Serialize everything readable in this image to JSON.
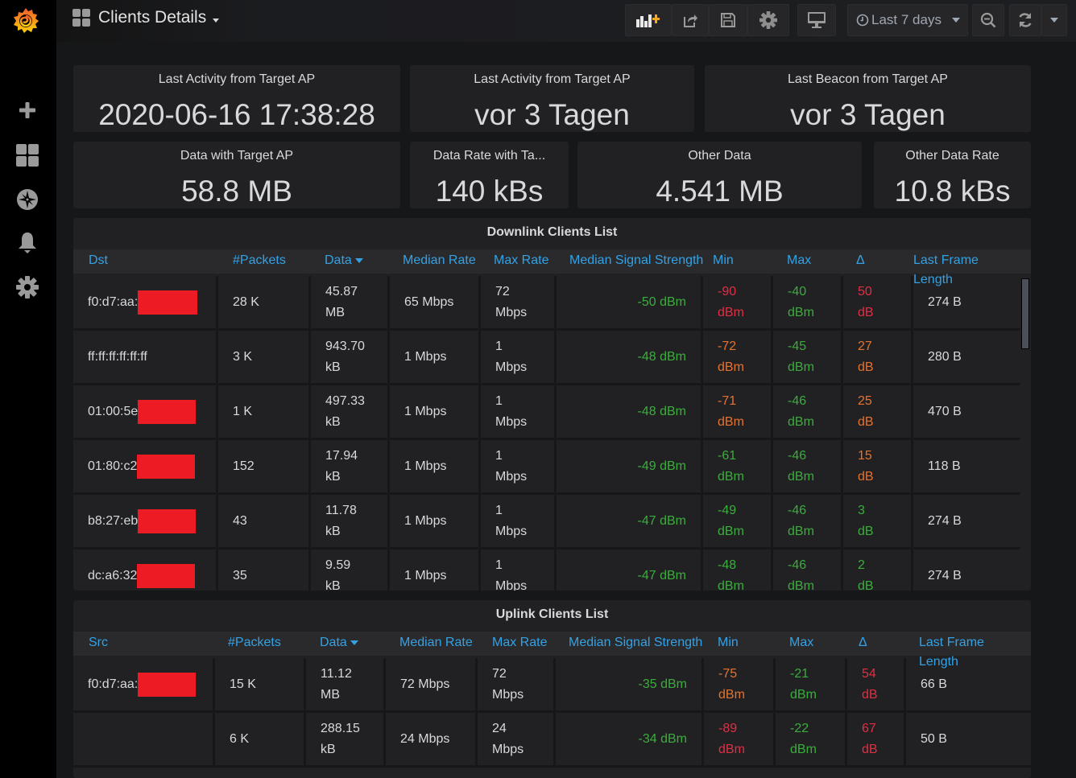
{
  "app": {
    "dashboard_title": "Clients Details"
  },
  "sidebar": {
    "items": [
      {
        "name": "create",
        "icon": "plus-icon"
      },
      {
        "name": "dashboards",
        "icon": "grid-icon"
      },
      {
        "name": "explore",
        "icon": "compass-icon"
      },
      {
        "name": "alerting",
        "icon": "bell-icon"
      },
      {
        "name": "configuration",
        "icon": "gear-icon"
      }
    ]
  },
  "toolbar": {
    "add_panel": "add-panel-icon",
    "share": "share-icon",
    "save": "save-icon",
    "settings": "gear-icon",
    "cycle_view": "monitor-icon",
    "time_range": "Last 7 days",
    "zoom_out": "zoom-out-icon",
    "refresh": "refresh-icon",
    "refresh_interval": "caret-down-icon"
  },
  "stats": [
    {
      "title": "Last Activity from Target AP",
      "value": "2020-06-16 17:38:28"
    },
    {
      "title": "Last Activity from Target AP",
      "value": "vor 3 Tagen"
    },
    {
      "title": "Last Beacon from Target AP",
      "value": "vor 3 Tagen"
    },
    {
      "title": "Data with Target AP",
      "value": "58.8 MB"
    },
    {
      "title": "Data Rate with Ta...",
      "value": "140 kBs"
    },
    {
      "title": "Other Data",
      "value": "4.541 MB"
    },
    {
      "title": "Other Data Rate",
      "value": "10.8 kBs"
    }
  ],
  "downlink": {
    "title": "Downlink Clients List",
    "columns": [
      "Dst",
      "#Packets",
      "Data",
      "Median Rate",
      "Max Rate",
      "Median Signal Strength",
      "Min",
      "Max",
      "Δ",
      "Last Frame",
      "Length"
    ],
    "sorted_column": "Data",
    "rows": [
      {
        "mac": "f0:d7:aa:",
        "redacted": true,
        "packets": "28 K",
        "data": [
          "45.87",
          "MB"
        ],
        "median_rate": "65 Mbps",
        "max_rate": [
          "72",
          "Mbps"
        ],
        "median_signal": "-50 dBm",
        "min": [
          "-90",
          "dBm"
        ],
        "min_color": "red",
        "max": [
          "-40",
          "dBm"
        ],
        "max_color": "green",
        "delta": [
          "50",
          "dB"
        ],
        "delta_color": "red",
        "last_frame": "274 B"
      },
      {
        "mac": "ff:ff:ff:ff:ff:ff",
        "redacted": false,
        "packets": "3 K",
        "data": [
          "943.70",
          "kB"
        ],
        "median_rate": "1 Mbps",
        "max_rate": [
          "1",
          "Mbps"
        ],
        "median_signal": "-48 dBm",
        "min": [
          "-72",
          "dBm"
        ],
        "min_color": "orange",
        "max": [
          "-45",
          "dBm"
        ],
        "max_color": "green",
        "delta": [
          "27",
          "dB"
        ],
        "delta_color": "orange",
        "last_frame": "280 B"
      },
      {
        "mac": "01:00:5e",
        "redacted": true,
        "packets": "1 K",
        "data": [
          "497.33",
          "kB"
        ],
        "median_rate": "1 Mbps",
        "max_rate": [
          "1",
          "Mbps"
        ],
        "median_signal": "-48 dBm",
        "min": [
          "-71",
          "dBm"
        ],
        "min_color": "orange",
        "max": [
          "-46",
          "dBm"
        ],
        "max_color": "green",
        "delta": [
          "25",
          "dB"
        ],
        "delta_color": "orange",
        "last_frame": "470 B"
      },
      {
        "mac": "01:80:c2",
        "redacted": true,
        "packets": "152",
        "data": [
          "17.94",
          "kB"
        ],
        "median_rate": "1 Mbps",
        "max_rate": [
          "1",
          "Mbps"
        ],
        "median_signal": "-49 dBm",
        "min": [
          "-61",
          "dBm"
        ],
        "min_color": "green",
        "max": [
          "-46",
          "dBm"
        ],
        "max_color": "green",
        "delta": [
          "15",
          "dB"
        ],
        "delta_color": "orange",
        "last_frame": "118 B"
      },
      {
        "mac": "b8:27:eb",
        "redacted": true,
        "packets": "43",
        "data": [
          "11.78",
          "kB"
        ],
        "median_rate": "1 Mbps",
        "max_rate": [
          "1",
          "Mbps"
        ],
        "median_signal": "-47 dBm",
        "min": [
          "-49",
          "dBm"
        ],
        "min_color": "green",
        "max": [
          "-46",
          "dBm"
        ],
        "max_color": "green",
        "delta": [
          "3",
          "dB"
        ],
        "delta_color": "green",
        "last_frame": "274 B"
      },
      {
        "mac": "dc:a6:32",
        "redacted": true,
        "packets": "35",
        "data": [
          "9.59",
          "kB"
        ],
        "median_rate": "1 Mbps",
        "max_rate": [
          "1",
          "Mbps"
        ],
        "median_signal": "-47 dBm",
        "min": [
          "-48",
          "dBm"
        ],
        "min_color": "green",
        "max": [
          "-46",
          "dBm"
        ],
        "max_color": "green",
        "delta": [
          "2",
          "dB"
        ],
        "delta_color": "green",
        "last_frame": "274 B"
      }
    ]
  },
  "uplink": {
    "title": "Uplink Clients List",
    "columns": [
      "Src",
      "#Packets",
      "Data",
      "Median Rate",
      "Max Rate",
      "Median Signal Strength",
      "Min",
      "Max",
      "Δ",
      "Last Frame",
      "Length"
    ],
    "sorted_column": "Data",
    "rows": [
      {
        "mac": "f0:d7:aa:",
        "redacted": true,
        "packets": "15 K",
        "data": [
          "11.12",
          "MB"
        ],
        "median_rate": "72 Mbps",
        "max_rate": [
          "72",
          "Mbps"
        ],
        "median_signal": "-35 dBm",
        "min": [
          "-75",
          "dBm"
        ],
        "min_color": "orange",
        "max": [
          "-21",
          "dBm"
        ],
        "max_color": "green",
        "delta": [
          "54",
          "dB"
        ],
        "delta_color": "red",
        "last_frame": "66 B"
      },
      {
        "mac": "",
        "redacted": false,
        "packets": "6 K",
        "data": [
          "288.15",
          "kB"
        ],
        "median_rate": "24 Mbps",
        "max_rate": [
          "24",
          "Mbps"
        ],
        "median_signal": "-34 dBm",
        "min": [
          "-89",
          "dBm"
        ],
        "min_color": "red",
        "max": [
          "-22",
          "dBm"
        ],
        "max_color": "green",
        "delta": [
          "67",
          "dB"
        ],
        "delta_color": "red",
        "last_frame": "50 B"
      }
    ]
  },
  "colors": {
    "accent": "#33a2e5",
    "green": "#3bad3c",
    "orange": "#e5732d",
    "red": "#e02f44",
    "redaction": "#ed1c24"
  }
}
